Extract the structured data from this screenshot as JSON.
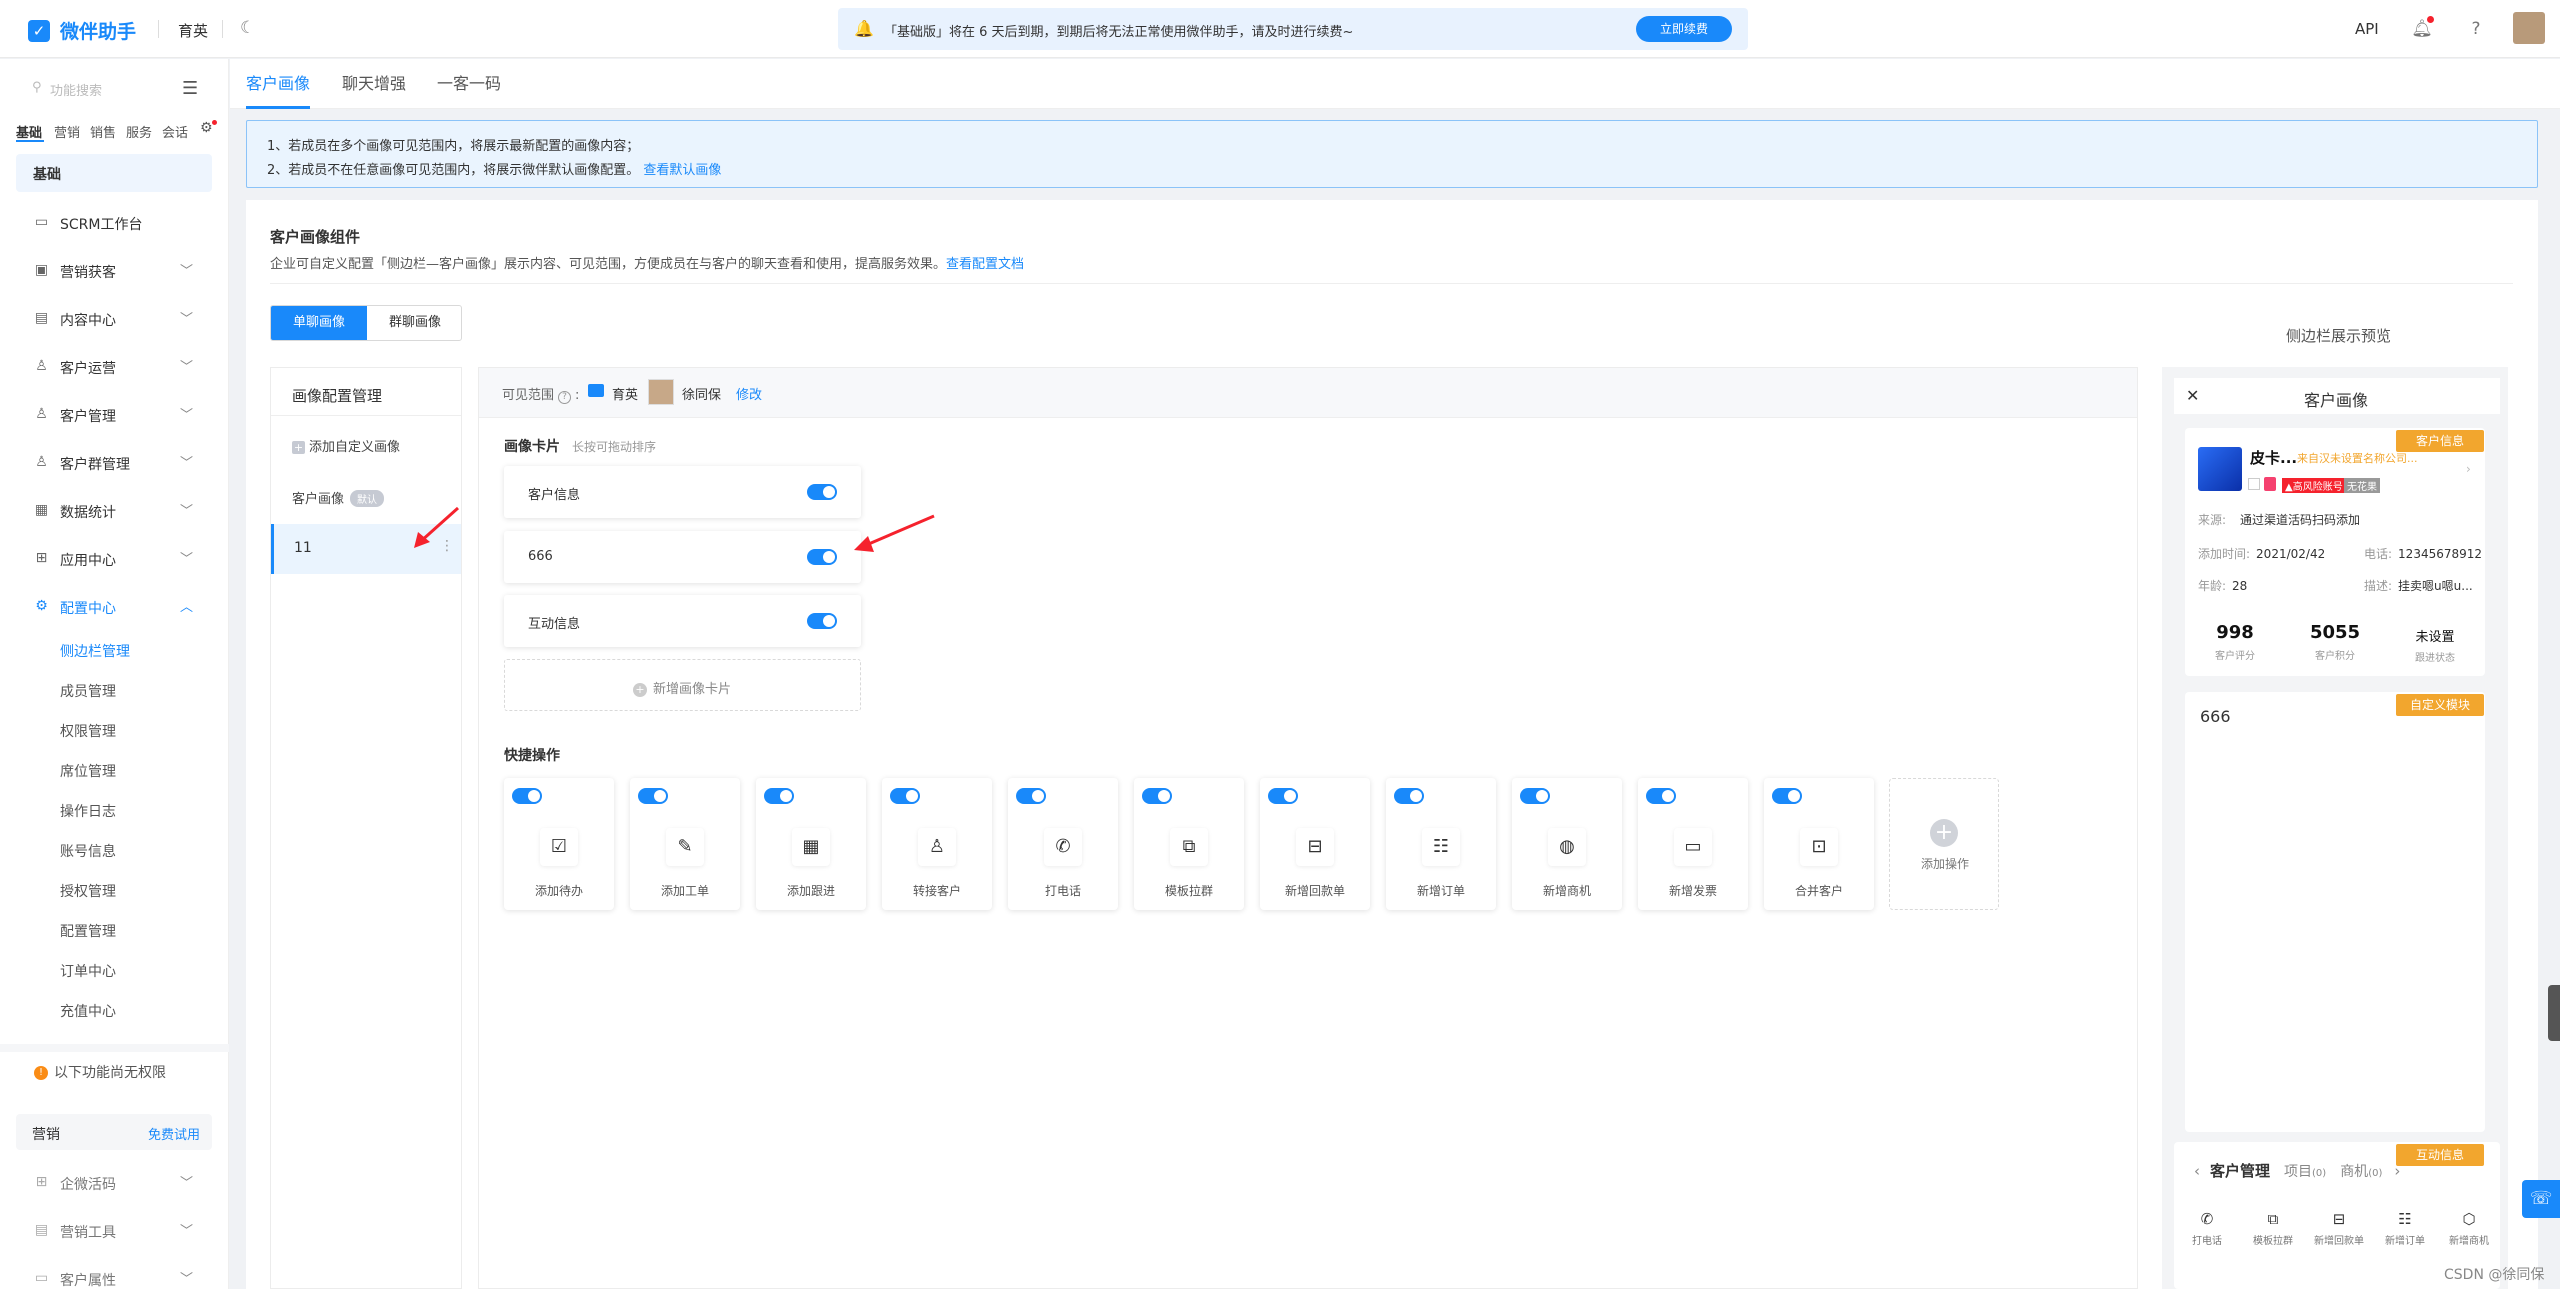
{
  "app": {
    "brand": "微伴助手",
    "org": "育英",
    "api": "API"
  },
  "notice": {
    "text": "「基础版」将在 6 天后到期，到期后将无法正常使用微伴助手，请及时进行续费~",
    "button": "立即续费"
  },
  "sidebar": {
    "search_placeholder": "功能搜索",
    "tabs": [
      "基础",
      "营销",
      "销售",
      "服务",
      "会话"
    ],
    "section": "基础",
    "items": [
      {
        "label": "SCRM工作台",
        "icon": "monitor-icon"
      },
      {
        "label": "营销获客",
        "icon": "megaphone-icon"
      },
      {
        "label": "内容中心",
        "icon": "content-icon"
      },
      {
        "label": "客户运营",
        "icon": "user-icon"
      },
      {
        "label": "客户管理",
        "icon": "users-icon"
      },
      {
        "label": "客户群管理",
        "icon": "group-icon"
      },
      {
        "label": "数据统计",
        "icon": "chart-icon"
      },
      {
        "label": "应用中心",
        "icon": "apps-icon"
      },
      {
        "label": "配置中心",
        "icon": "gear-icon"
      }
    ],
    "subitems": [
      "侧边栏管理",
      "成员管理",
      "权限管理",
      "席位管理",
      "操作日志",
      "账号信息",
      "授权管理",
      "配置管理",
      "订单中心",
      "充值中心"
    ],
    "no_perm": "以下功能尚无权限",
    "market": {
      "label": "营销",
      "trial": "免费试用"
    },
    "locked_items": [
      "企微活码",
      "营销工具",
      "客户属性"
    ]
  },
  "tabs": [
    "客户画像",
    "聊天增强",
    "一客一码"
  ],
  "tips": {
    "line1": "1、若成员在多个画像可见范围内，将展示最新配置的画像内容；",
    "line2": "2、若成员不在任意画像可见范围内，将展示微伴默认画像配置。",
    "line2_link": "查看默认画像"
  },
  "component": {
    "title": "客户画像组件",
    "desc": "企业可自定义配置「侧边栏—客户画像」展示内容、可见范围，方便成员在与客户的聊天查看和使用，提高服务效果。",
    "desc_link": "查看配置文档",
    "seg": [
      "单聊画像",
      "群聊画像"
    ]
  },
  "config": {
    "title": "画像配置管理",
    "add": "添加自定义画像",
    "default_name": "客户画像",
    "default_badge": "默认",
    "selected": "11"
  },
  "editor": {
    "scope_label": "可见范围",
    "scope_org": "育英",
    "scope_user": "徐同保",
    "edit": "修改",
    "cards_title": "画像卡片",
    "cards_hint": "长按可拖动排序",
    "cards": [
      "客户信息",
      "666",
      "互动信息"
    ],
    "add_card": "新增画像卡片",
    "quick_title": "快捷操作",
    "quick": [
      {
        "label": "添加待办",
        "icon": "todo-icon"
      },
      {
        "label": "添加工单",
        "icon": "ticket-icon"
      },
      {
        "label": "添加跟进",
        "icon": "followup-icon"
      },
      {
        "label": "转接客户",
        "icon": "transfer-icon"
      },
      {
        "label": "打电话",
        "icon": "phone-icon"
      },
      {
        "label": "模板拉群",
        "icon": "template-group-icon"
      },
      {
        "label": "新增回款单",
        "icon": "payment-icon"
      },
      {
        "label": "新增订单",
        "icon": "order-icon"
      },
      {
        "label": "新增商机",
        "icon": "opportunity-icon"
      },
      {
        "label": "新增发票",
        "icon": "invoice-icon"
      },
      {
        "label": "合并客户",
        "icon": "merge-icon"
      }
    ],
    "quick_add": "添加操作"
  },
  "preview": {
    "title": "侧边栏展示预览",
    "phone_title": "客户画像",
    "ribbons": [
      "客户信息",
      "自定义模块",
      "互动信息"
    ],
    "customer": {
      "name": "皮卡...",
      "corp": "来自汉未设置名称公司...",
      "risk": "高风险账号",
      "nick": "无花果",
      "source_label": "来源:",
      "source": "通过渠道活码扫码添加",
      "added_label": "添加时间:",
      "added": "2021/02/42",
      "phone_label": "电话:",
      "phone": "12345678912",
      "age_label": "年龄:",
      "age": "28",
      "desc_label": "描述:",
      "desc": "挂卖嗯u嗯u..."
    },
    "stats": [
      {
        "value": "998",
        "label": "客户评分"
      },
      {
        "value": "5055",
        "label": "客户积分"
      },
      {
        "value": "未设置",
        "label": "跟进状态"
      }
    ],
    "custom_title": "666",
    "bottom_tabs": [
      "客户管理",
      "项目",
      "商机"
    ],
    "bottom_tab_counts": [
      "(0)",
      "(0)"
    ],
    "bottom_quick": [
      "打电话",
      "模板拉群",
      "新增回款单",
      "新增订单",
      "新增商机"
    ]
  },
  "watermark": "CSDN @徐同保",
  "colors": {
    "accent": "#1989fa",
    "ribbon": "#f2a62e",
    "danger": "#f5222d"
  }
}
